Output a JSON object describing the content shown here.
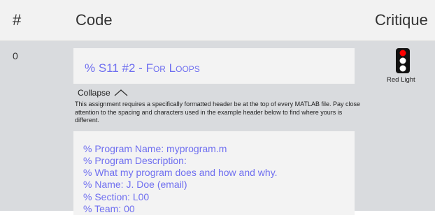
{
  "table": {
    "headers": {
      "number": "#",
      "code": "Code",
      "critique": "Critique"
    }
  },
  "row": {
    "index": "0",
    "header_line": {
      "prefix": "% S11 #2 - ",
      "title": "For Loops"
    },
    "collapse_label": "Collapse",
    "explanation": "This assignment requires a specifically formatted header be at the top of every MATLAB file. Pay close attention to the spacing and characters used in the example header below to find where yours is different.",
    "code_lines": [
      "% Program Name: myprogram.m",
      "% Program Description:",
      "% What my program does and how and why.",
      "% Name: J. Doe (email)",
      "% Section: L00",
      "% Team: 00"
    ],
    "critique": {
      "label": "Red Light",
      "icon": "traffic-light-icon",
      "status_color": "#ff0000"
    }
  },
  "colors": {
    "code_text": "#6f6ff0",
    "row_bg": "#d9dbde",
    "header_bg": "#f2f2f2"
  }
}
